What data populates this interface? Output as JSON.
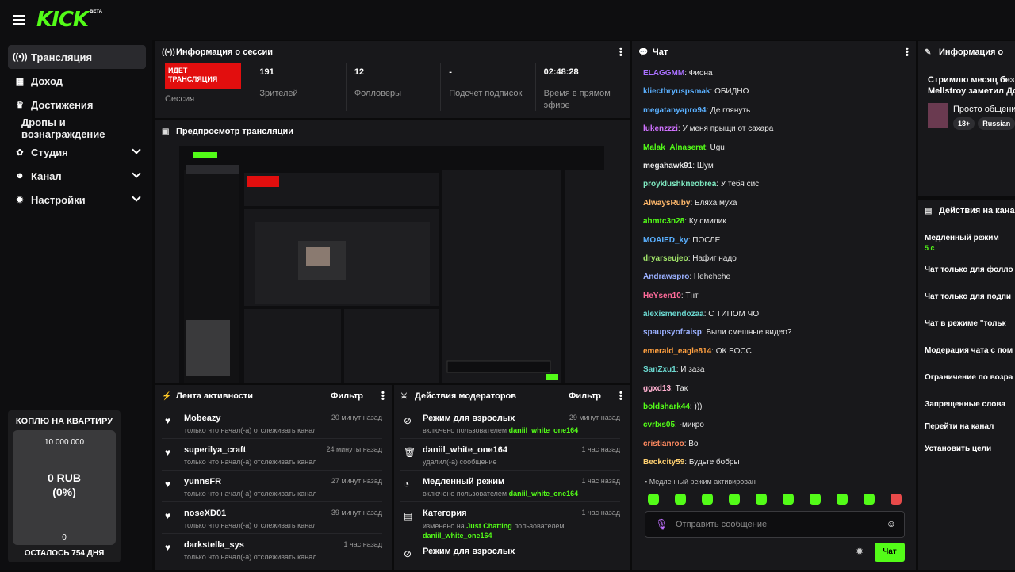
{
  "brand": {
    "logo": "KICK",
    "beta": "BETA",
    "accent": "#53fc18"
  },
  "sidebar": {
    "items": [
      {
        "label": "Трансляция",
        "icon": "broadcast-icon"
      },
      {
        "label": "Доход",
        "icon": "revenue-icon"
      },
      {
        "label": "Достижения",
        "icon": "trophy-icon"
      },
      {
        "label": "Дропы и вознаграждение",
        "icon": ""
      },
      {
        "label": "Студия",
        "icon": "studio-icon"
      },
      {
        "label": "Канал",
        "icon": "channel-icon"
      },
      {
        "label": "Настройки",
        "icon": "gear-icon"
      }
    ]
  },
  "goal": {
    "title": "КОПЛЮ НА КВАРТИРУ",
    "target": "10 000 000",
    "amount": "0 RUB",
    "percent": "(0%)",
    "current": "0",
    "days_left": "ОСТАЛОСЬ 754 ДНЯ"
  },
  "session": {
    "title": "Информация о сессии",
    "live_label": "ИДЕТ ТРАНСЛЯЦИЯ",
    "session_label": "Сессия",
    "stats": [
      {
        "value": "191",
        "label": "Зрителей"
      },
      {
        "value": "12",
        "label": "Фолловеры"
      },
      {
        "value": "-",
        "label": "Подсчет подписок"
      },
      {
        "value": "02:48:28",
        "label": "Время в прямом эфире"
      }
    ]
  },
  "preview": {
    "title": "Предпросмотр трансляции"
  },
  "activity": {
    "title": "Лента активности",
    "filter": "Фильтр",
    "items": [
      {
        "name": "Mobeazy",
        "desc": "только что начал(-а) отслеживать канал",
        "time": "20 минут назад"
      },
      {
        "name": "superilya_craft",
        "desc": "только что начал(-а) отслеживать канал",
        "time": "24 минуты назад"
      },
      {
        "name": "yunnsFR",
        "desc": "только что начал(-а) отслеживать канал",
        "time": "27 минут назад"
      },
      {
        "name": "noseXD01",
        "desc": "только что начал(-а) отслеживать канал",
        "time": "39 минут назад"
      },
      {
        "name": "darkstella_sys",
        "desc": "только что начал(-а) отслеживать канал",
        "time": "1 час назад"
      }
    ]
  },
  "mod_actions": {
    "title": "Действия модераторов",
    "filter": "Фильтр",
    "items": [
      {
        "name": "Режим для взрослых",
        "desc": "включено пользователем",
        "user": "daniil_white_one164",
        "time": "29 минут назад",
        "icon": "adult-mode-icon"
      },
      {
        "name": "daniil_white_one164",
        "desc": "удалил(-а) сообщение",
        "user": "",
        "time": "1 час назад",
        "icon": "trash-icon"
      },
      {
        "name": "Медленный режим",
        "desc": "включено пользователем",
        "user": "daniil_white_one164",
        "time": "1 час назад",
        "icon": "slow-mode-icon"
      },
      {
        "name": "Категория",
        "desc": "изменено на",
        "category": "Just Chatting",
        "desc2": "пользователем",
        "user": "daniil_white_one164",
        "time": "1 час назад",
        "icon": "category-icon"
      },
      {
        "name": "Режим для взрослых",
        "desc": "",
        "user": "",
        "time": "",
        "icon": "adult-mode-icon"
      }
    ]
  },
  "chat": {
    "title": "Чат",
    "messages": [
      {
        "user": "ELAGGMM",
        "color": "#a970ff",
        "text": "Фиона"
      },
      {
        "user": "kliecthryuspsmak",
        "color": "#5ab0ff",
        "text": "ОБИДНО"
      },
      {
        "user": "megatanyapro94",
        "color": "#5ab0ff",
        "text": "Де глянуть"
      },
      {
        "user": "lukenzzzi",
        "color": "#d071ff",
        "text": "У меня прыщи от сахара"
      },
      {
        "user": "Malak_Alnaserat",
        "color": "#53fc18",
        "text": "Ugu"
      },
      {
        "user": "megahawk91",
        "color": "#e8e8e8",
        "text": "Шум"
      },
      {
        "user": "proyklushkneobrea",
        "color": "#7ee8c0",
        "text": "У тебя сис"
      },
      {
        "user": "AlwaysRuby",
        "color": "#ffb86b",
        "text": "Бляха муха"
      },
      {
        "user": "ahmtc3n28",
        "color": "#53fc18",
        "text": "Ку смилик"
      },
      {
        "user": "MOAIED_ky",
        "color": "#5ab0ff",
        "text": "ПОСЛЕ"
      },
      {
        "user": "dryarseujeo",
        "color": "#a4e86b",
        "text": "Нафиг надо"
      },
      {
        "user": "Andrawspro",
        "color": "#9ab0ff",
        "text": "Hehehehe"
      },
      {
        "user": "HeYsen10",
        "color": "#ff6b9a",
        "text": "Тнт"
      },
      {
        "user": "alexismendozaa",
        "color": "#6bd8d0",
        "text": "С ТИПОМ ЧО"
      },
      {
        "user": "spaupsyofraisp",
        "color": "#9ab0ff",
        "text": "Были смешные видео?"
      },
      {
        "user": "emerald_eagle814",
        "color": "#ffa040",
        "text": "ОК БОСС"
      },
      {
        "user": "SanZxu1",
        "color": "#6bd8d0",
        "text": "И заза"
      },
      {
        "user": "ggxd13",
        "color": "#ffb0d0",
        "text": "Так"
      },
      {
        "user": "boldshark44",
        "color": "#53fc18",
        "text": ")))"
      },
      {
        "user": "cvrlxs05",
        "color": "#53fc18",
        "text": "-микро"
      },
      {
        "user": "cristianroo",
        "color": "#ff8a60",
        "text": "Во"
      },
      {
        "user": "Beckcity59",
        "color": "#ffd070",
        "text": "Будьте бобры"
      }
    ],
    "slow_mode_notice": "Медленный режим активирован",
    "input_placeholder": "Отправить сообщение",
    "send_label": "Чат"
  },
  "session_right": {
    "title": "Информация о",
    "stream_title": "Стримлю месяц без",
    "stream_title2": "Mellstroy заметил До",
    "stream_sub": "Просто общени",
    "tags": [
      "18+",
      "Russian"
    ]
  },
  "mod_panel": {
    "title": "Действия на кана",
    "slow_mode": "Медленный режим",
    "slow_mode_value": "5 с",
    "items": [
      "Чат только для фолло",
      "Чат только для подпи",
      "Чат в режиме \"тольк",
      "Модерация чата с пом",
      "Ограничение по возра",
      "Запрещенные слова",
      "Перейти на канал",
      "Установить цели"
    ]
  }
}
